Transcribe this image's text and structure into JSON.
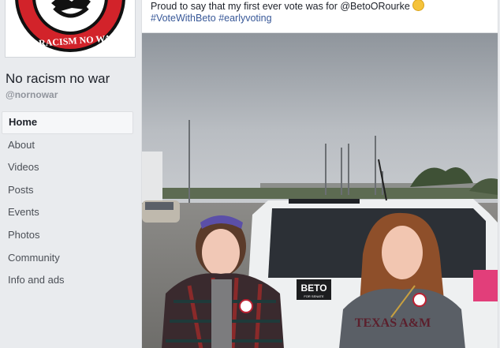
{
  "page": {
    "name": "No racism no war",
    "handle": "@nornowar",
    "logo_text": "NO RACISM NO WAR"
  },
  "nav": {
    "items": [
      {
        "label": "Home"
      },
      {
        "label": "About"
      },
      {
        "label": "Videos"
      },
      {
        "label": "Posts"
      },
      {
        "label": "Events"
      },
      {
        "label": "Photos"
      },
      {
        "label": "Community"
      },
      {
        "label": "Info and ads"
      }
    ]
  },
  "post": {
    "text": "Proud to say that my first ever vote was for @BetoORourke",
    "hashtags": [
      "#VoteWithBeto",
      "#earlyvoting"
    ],
    "photo_car_sticker": "BETO",
    "photo_car_sticker_sub": "FOR SENATE",
    "photo_shirt_text": "TEXAS A&M"
  },
  "colors": {
    "link": "#385898",
    "background": "#e9ebee",
    "logo_red": "#d2232a"
  },
  "icons": {
    "post_emoji": "grinning-face-icon"
  }
}
